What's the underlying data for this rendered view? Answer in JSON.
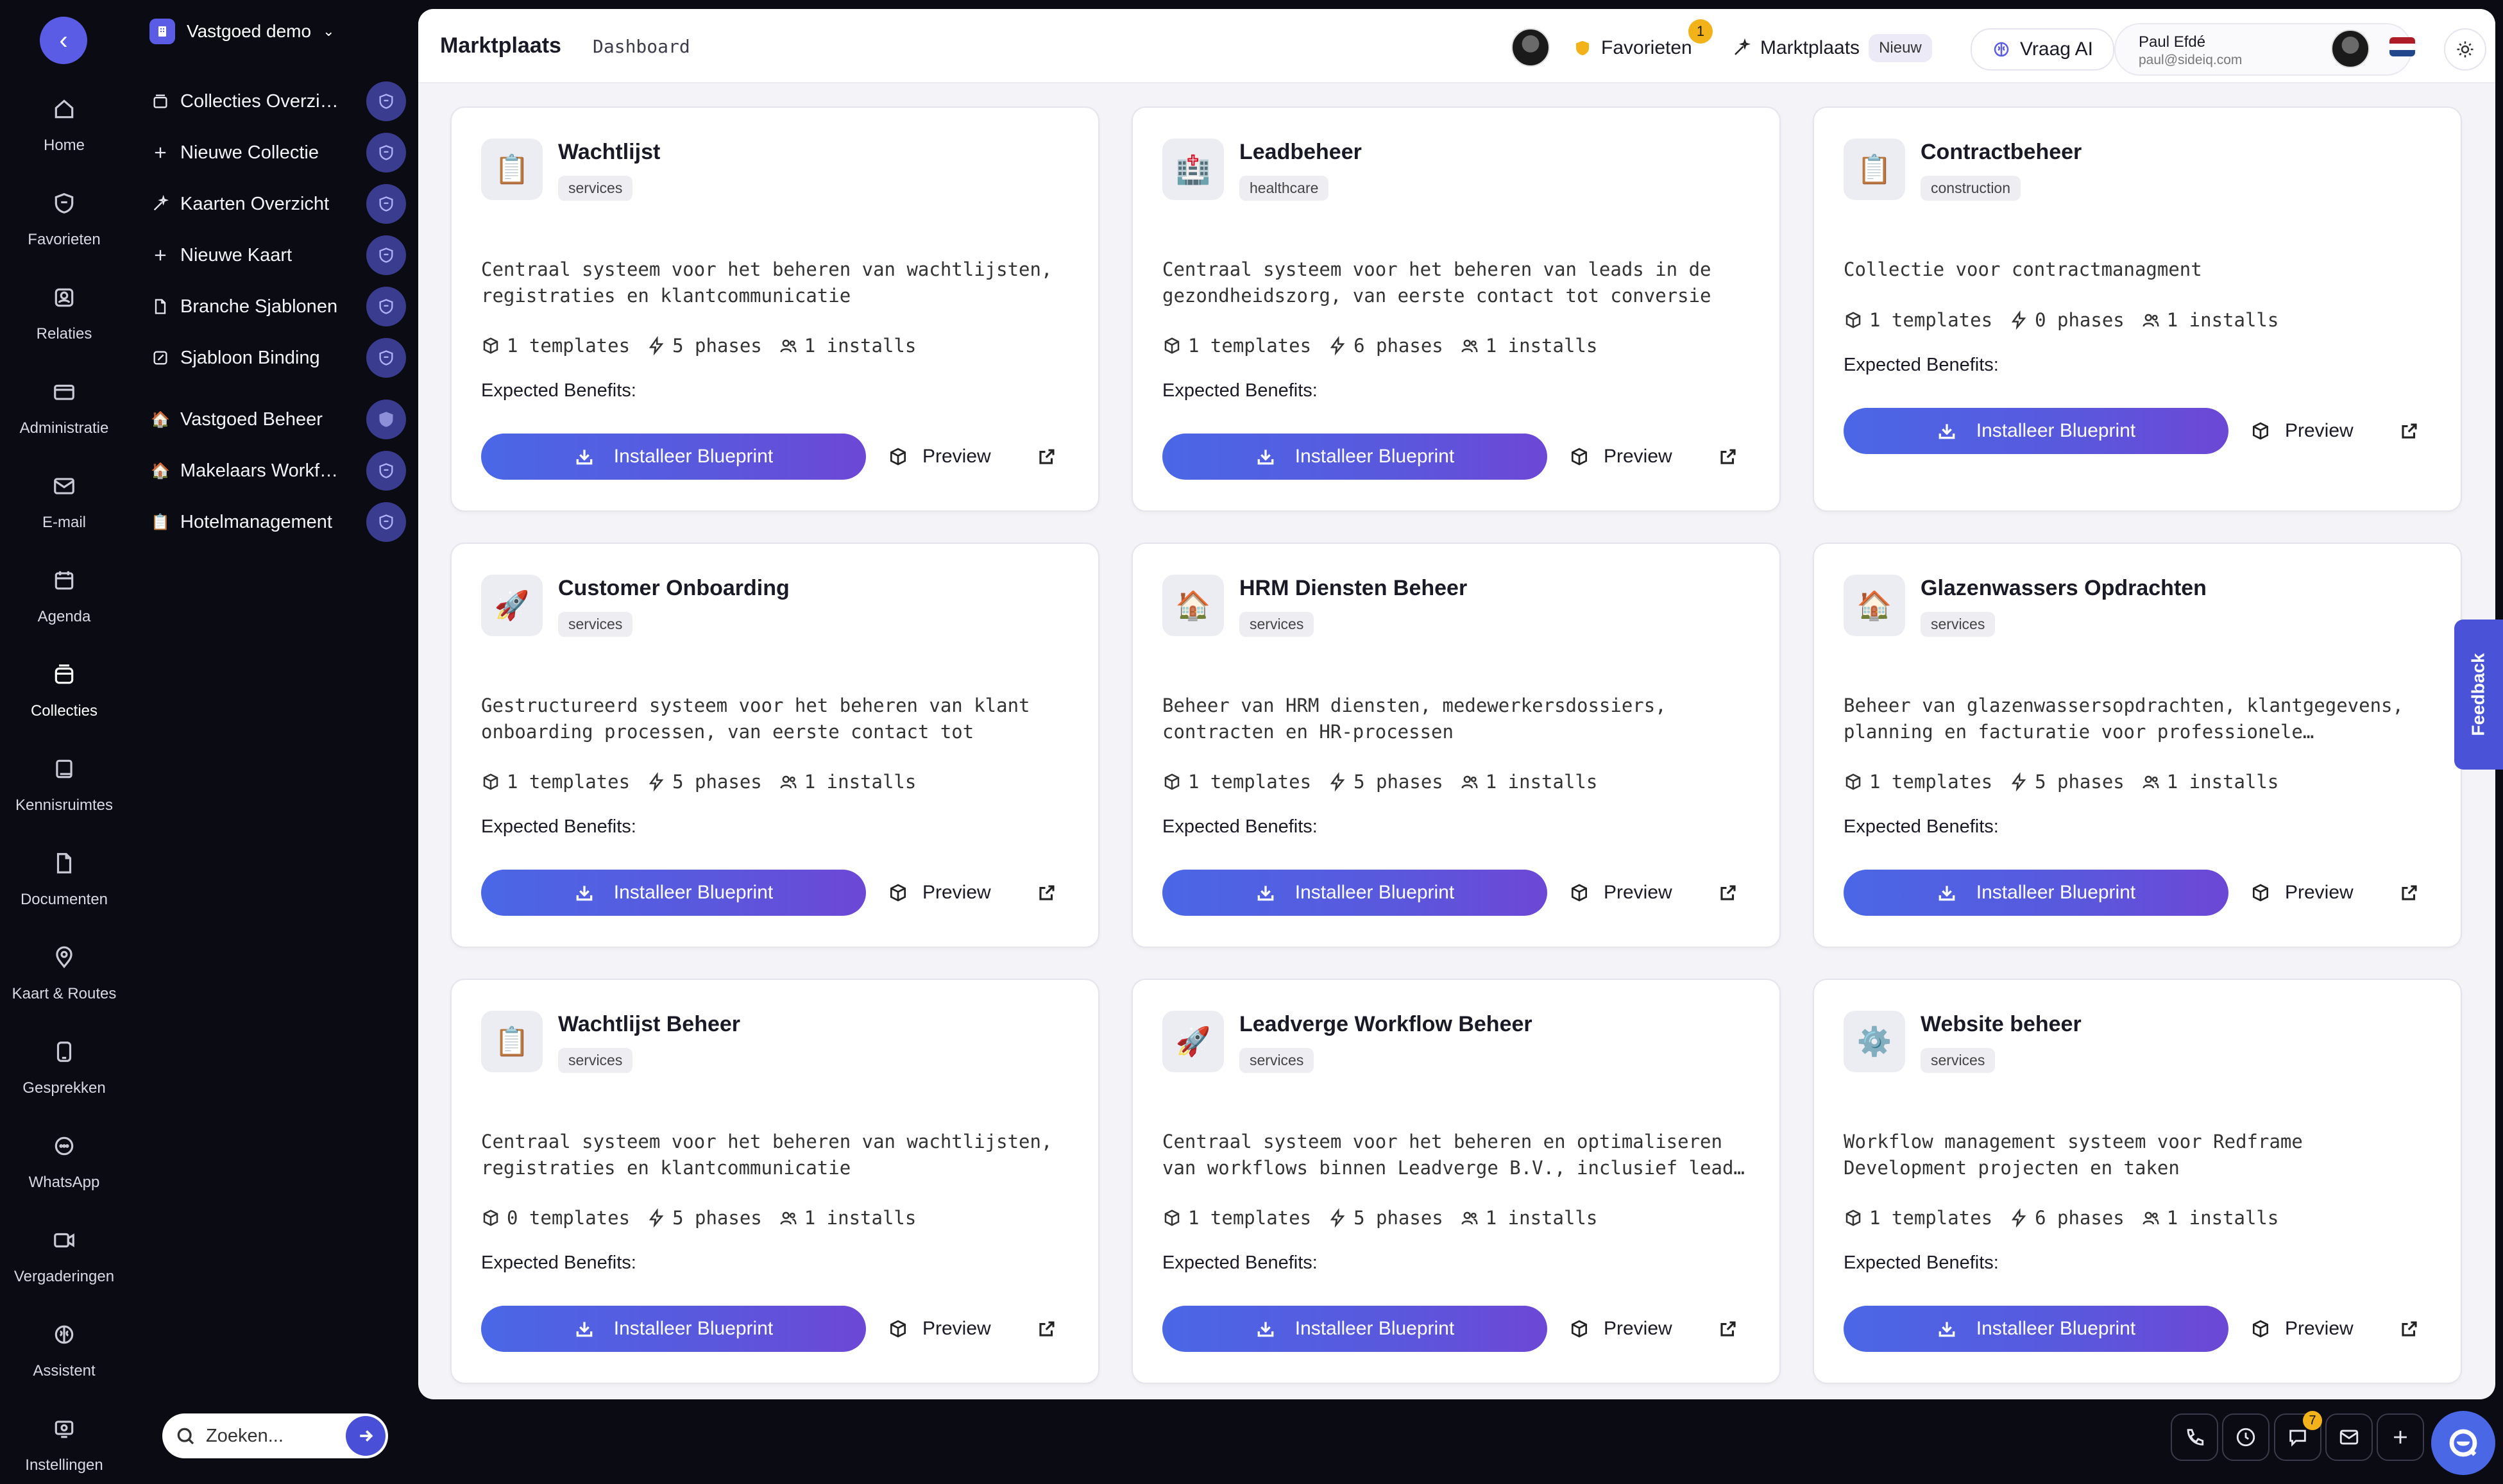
{
  "rail": {
    "items": [
      {
        "label": "Home",
        "icon": "home-icon"
      },
      {
        "label": "Favorieten",
        "icon": "shield-icon"
      },
      {
        "label": "Relaties",
        "icon": "contacts-icon"
      },
      {
        "label": "Administratie",
        "icon": "wallet-icon"
      },
      {
        "label": "E-mail",
        "icon": "mail-icon"
      },
      {
        "label": "Agenda",
        "icon": "calendar-icon"
      },
      {
        "label": "Collecties",
        "icon": "box-icon"
      },
      {
        "label": "Kennisruimtes",
        "icon": "book-icon"
      },
      {
        "label": "Documenten",
        "icon": "document-icon"
      },
      {
        "label": "Kaart & Routes",
        "icon": "map-pin-icon"
      },
      {
        "label": "Gesprekken",
        "icon": "phone-icon"
      },
      {
        "label": "WhatsApp",
        "icon": "chat-bubble-icon"
      },
      {
        "label": "Vergaderingen",
        "icon": "video-icon"
      },
      {
        "label": "Assistent",
        "icon": "brain-icon"
      },
      {
        "label": "Instellingen",
        "icon": "settings-icon"
      }
    ]
  },
  "sidebar": {
    "workspace": "Vastgoed demo",
    "items": [
      {
        "label": "Collecties Overzicht",
        "icon": "collection-icon"
      },
      {
        "label": "Nieuwe Collectie",
        "icon": "plus-icon"
      },
      {
        "label": "Kaarten Overzicht",
        "icon": "sparkle-icon"
      },
      {
        "label": "Nieuwe Kaart",
        "icon": "plus-icon"
      },
      {
        "label": "Branche Sjablonen",
        "icon": "document-icon"
      },
      {
        "label": "Sjabloon Binding",
        "icon": "edit-icon"
      },
      {
        "label": "Vastgoed Beheer",
        "icon": "house-emoji",
        "glyph": "🏠"
      },
      {
        "label": "Makelaars Workflow",
        "icon": "house-emoji",
        "glyph": "🏠"
      },
      {
        "label": "Hotelmanagement",
        "icon": "clipboard-emoji",
        "glyph": "📋"
      }
    ],
    "search_placeholder": "Zoeken..."
  },
  "topbar": {
    "brand": "Marktplaats",
    "breadcrumb": "Dashboard",
    "favorites_label": "Favorieten",
    "favorites_count": "1",
    "marketplace_label": "Marktplaats",
    "marketplace_badge": "Nieuw",
    "ask_ai_label": "Vraag AI",
    "user_name": "Paul Efdé",
    "user_email": "paul@sideiq.com"
  },
  "labels": {
    "expected_benefits": "Expected Benefits:",
    "install": "Installeer Blueprint",
    "preview": "Preview"
  },
  "cards": [
    {
      "title": "Wachtlijst",
      "tag": "services",
      "emoji": "📋",
      "desc": "Centraal systeem voor het beheren van wachtlijsten, registraties en klantcommunicatie",
      "templates": "1 templates",
      "phases": "5 phases",
      "installs": "1 installs"
    },
    {
      "title": "Leadbeheer",
      "tag": "healthcare",
      "emoji": "🏥",
      "desc": "Centraal systeem voor het beheren van leads in de gezondheidszorg, van eerste contact tot conversie",
      "templates": "1 templates",
      "phases": "6 phases",
      "installs": "1 installs"
    },
    {
      "title": "Contractbeheer",
      "tag": "construction",
      "emoji": "📋",
      "desc": "Collectie voor contractmanagment",
      "templates": "1 templates",
      "phases": "0 phases",
      "installs": "1 installs"
    },
    {
      "title": "Customer Onboarding",
      "tag": "services",
      "emoji": "🚀",
      "desc": "Gestructureerd systeem voor het beheren van klant onboarding processen, van eerste contact tot volledige…",
      "templates": "1 templates",
      "phases": "5 phases",
      "installs": "1 installs"
    },
    {
      "title": "HRM Diensten Beheer",
      "tag": "services",
      "emoji": "🏠",
      "desc": "Beheer van HRM diensten, medewerkersdossiers, contracten en HR-processen",
      "templates": "1 templates",
      "phases": "5 phases",
      "installs": "1 installs"
    },
    {
      "title": "Glazenwassers Opdrachten",
      "tag": "services",
      "emoji": "🏠",
      "desc": "Beheer van glazenwassersopdrachten, klantgegevens, planning en facturatie voor professionele…",
      "templates": "1 templates",
      "phases": "5 phases",
      "installs": "1 installs"
    },
    {
      "title": "Wachtlijst Beheer",
      "tag": "services",
      "emoji": "📋",
      "desc": "Centraal systeem voor het beheren van wachtlijsten, registraties en klantcommunicatie",
      "templates": "0 templates",
      "phases": "5 phases",
      "installs": "1 installs"
    },
    {
      "title": "Leadverge Workflow Beheer",
      "tag": "services",
      "emoji": "🚀",
      "desc": "Centraal systeem voor het beheren en optimaliseren van workflows binnen Leadverge B.V., inclusief lead…",
      "templates": "1 templates",
      "phases": "5 phases",
      "installs": "1 installs"
    },
    {
      "title": "Website beheer",
      "tag": "services",
      "emoji": "⚙️",
      "desc": "Workflow management systeem voor Redframe Development projecten en taken",
      "templates": "1 templates",
      "phases": "6 phases",
      "installs": "1 installs"
    }
  ],
  "feedback_label": "Feedback",
  "dock": {
    "notification_count": "7"
  },
  "colors": {
    "accent": "#5b5ce6",
    "install_gradient_start": "#4a67e6",
    "install_gradient_end": "#6d47d6",
    "badge": "#f1b21a"
  }
}
